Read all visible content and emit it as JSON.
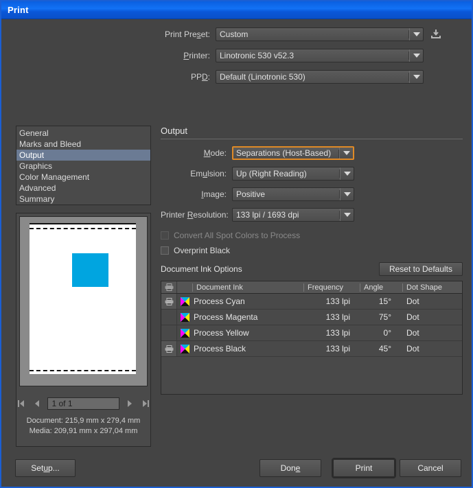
{
  "window": {
    "title": "Print"
  },
  "presets": {
    "print_preset_label": "Print Preset:",
    "print_preset_value": "Custom",
    "printer_label": "Printer:",
    "printer_value": "Linotronic 530 v52.3",
    "ppd_label": "PPD:",
    "ppd_value": "Default (Linotronic 530)",
    "save_preset_icon": "save-preset-icon"
  },
  "nav": {
    "items": [
      {
        "label": "General",
        "selected": false
      },
      {
        "label": "Marks and Bleed",
        "selected": false
      },
      {
        "label": "Output",
        "selected": true
      },
      {
        "label": "Graphics",
        "selected": false
      },
      {
        "label": "Color Management",
        "selected": false
      },
      {
        "label": "Advanced",
        "selected": false
      },
      {
        "label": "Summary",
        "selected": false
      }
    ]
  },
  "preview": {
    "page_field_value": "1 of 1",
    "document_size": "Document: 215,9 mm x 279,4 mm",
    "media_size": "Media: 209,91 mm x 297,04 mm",
    "art_color": "#00a5e0",
    "first_page_icon": "first-page-icon",
    "prev_page_icon": "previous-page-icon",
    "next_page_icon": "next-page-icon",
    "last_page_icon": "last-page-icon"
  },
  "output": {
    "section_title": "Output",
    "mode_label": "Mode:",
    "mode_value": "Separations (Host-Based)",
    "emulsion_label": "Emulsion:",
    "emulsion_value": "Up (Right Reading)",
    "image_label": "Image:",
    "image_value": "Positive",
    "resolution_label": "Printer Resolution:",
    "resolution_value": "133 lpi / 1693 dpi",
    "convert_spot_label": "Convert All Spot Colors to Process",
    "convert_spot_checked": false,
    "convert_spot_disabled": true,
    "overprint_black_label": "Overprint Black",
    "overprint_black_checked": false,
    "focus_color": "#e08a26"
  },
  "ink_options": {
    "heading": "Document Ink Options",
    "reset_label": "Reset to Defaults",
    "columns": {
      "print_icon": "printer-icon",
      "document_ink": "Document Ink",
      "frequency": "Frequency",
      "angle": "Angle",
      "dot_shape": "Dot Shape"
    },
    "rows": [
      {
        "print": true,
        "ink": "Process Cyan",
        "frequency": "133 lpi",
        "angle": "15°",
        "dot_shape": "Dot"
      },
      {
        "print": false,
        "ink": "Process Magenta",
        "frequency": "133 lpi",
        "angle": "75°",
        "dot_shape": "Dot"
      },
      {
        "print": false,
        "ink": "Process Yellow",
        "frequency": "133 lpi",
        "angle": "0°",
        "dot_shape": "Dot"
      },
      {
        "print": true,
        "ink": "Process Black",
        "frequency": "133 lpi",
        "angle": "45°",
        "dot_shape": "Dot"
      }
    ]
  },
  "buttons": {
    "setup": "Setup...",
    "done": "Done",
    "print": "Print",
    "cancel": "Cancel"
  }
}
